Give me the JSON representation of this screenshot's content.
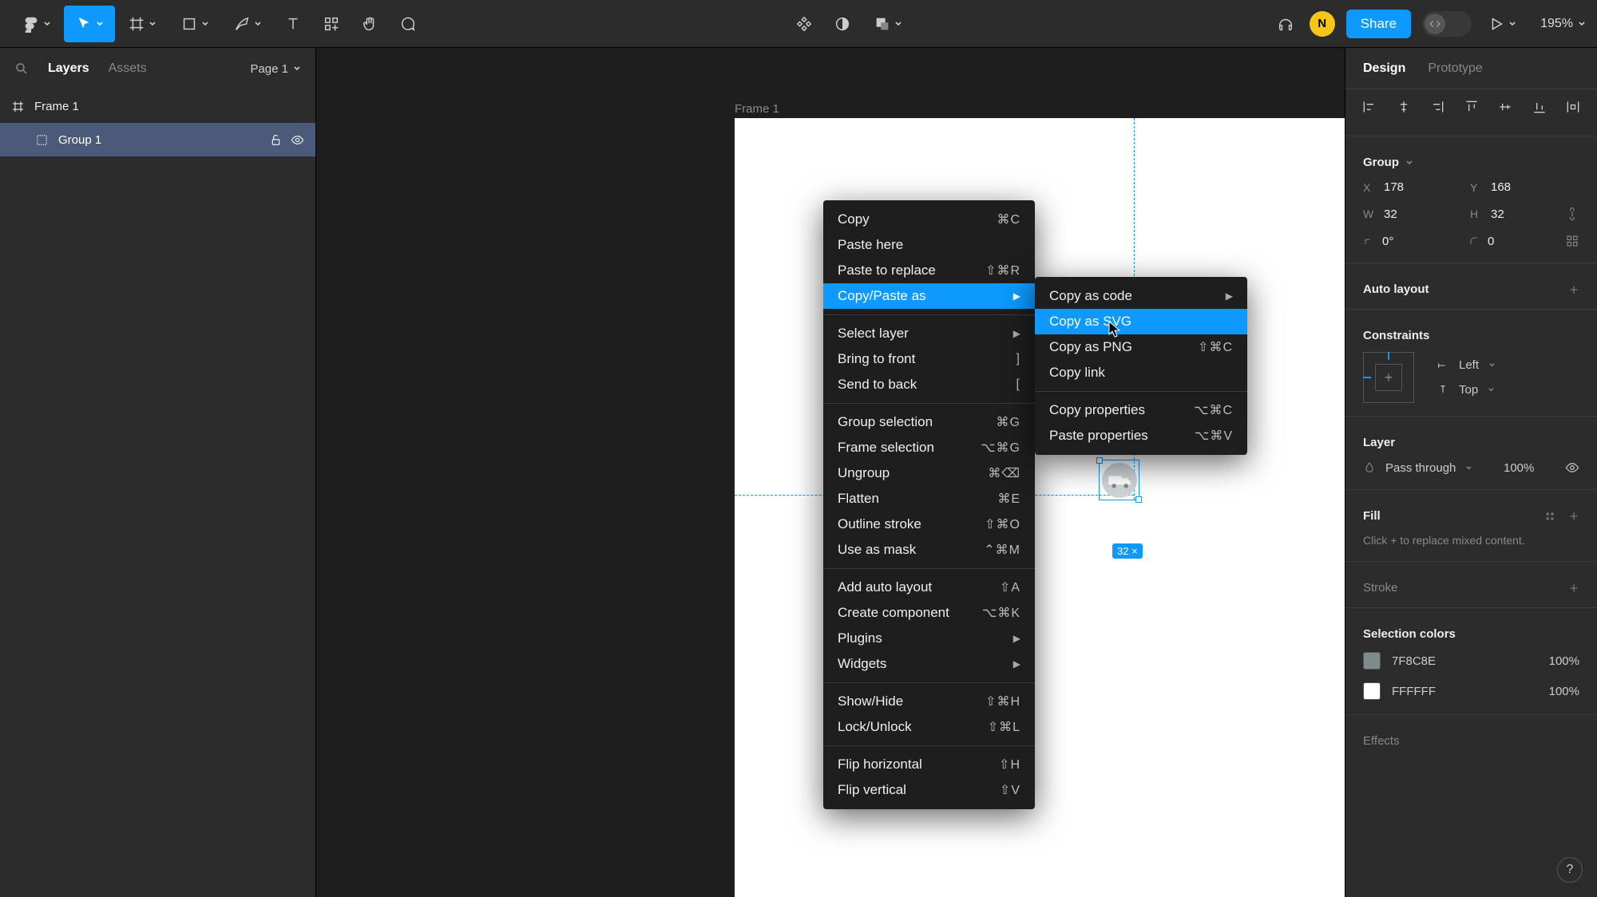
{
  "topbar": {
    "share": "Share",
    "zoom": "195%",
    "avatar_initial": "N"
  },
  "leftpanel": {
    "tabs": {
      "layers": "Layers",
      "assets": "Assets"
    },
    "page_selector": "Page 1",
    "layers": [
      {
        "name": "Frame 1",
        "type": "frame"
      },
      {
        "name": "Group 1",
        "type": "group",
        "selected": true
      }
    ]
  },
  "canvas": {
    "frame_label": "Frame 1",
    "selection_dims": "32 ×"
  },
  "context_menu": {
    "items": [
      {
        "label": "Copy",
        "shortcut": "⌘C"
      },
      {
        "label": "Paste here",
        "shortcut": ""
      },
      {
        "label": "Paste to replace",
        "shortcut": "⇧⌘R"
      },
      {
        "label": "Copy/Paste as",
        "shortcut": "",
        "submenu": true,
        "hov": true
      },
      {
        "sep": true
      },
      {
        "label": "Select layer",
        "shortcut": "",
        "submenu": true
      },
      {
        "label": "Bring to front",
        "shortcut": "]"
      },
      {
        "label": "Send to back",
        "shortcut": "["
      },
      {
        "sep": true
      },
      {
        "label": "Group selection",
        "shortcut": "⌘G"
      },
      {
        "label": "Frame selection",
        "shortcut": "⌥⌘G"
      },
      {
        "label": "Ungroup",
        "shortcut": "⌘⌫"
      },
      {
        "label": "Flatten",
        "shortcut": "⌘E"
      },
      {
        "label": "Outline stroke",
        "shortcut": "⇧⌘O"
      },
      {
        "label": "Use as mask",
        "shortcut": "⌃⌘M"
      },
      {
        "sep": true
      },
      {
        "label": "Add auto layout",
        "shortcut": "⇧A"
      },
      {
        "label": "Create component",
        "shortcut": "⌥⌘K"
      },
      {
        "label": "Plugins",
        "shortcut": "",
        "submenu": true
      },
      {
        "label": "Widgets",
        "shortcut": "",
        "submenu": true
      },
      {
        "sep": true
      },
      {
        "label": "Show/Hide",
        "shortcut": "⇧⌘H"
      },
      {
        "label": "Lock/Unlock",
        "shortcut": "⇧⌘L"
      },
      {
        "sep": true
      },
      {
        "label": "Flip horizontal",
        "shortcut": "⇧H"
      },
      {
        "label": "Flip vertical",
        "shortcut": "⇧V"
      }
    ]
  },
  "submenu": {
    "items": [
      {
        "label": "Copy as code",
        "shortcut": "",
        "submenu": true
      },
      {
        "label": "Copy as SVG",
        "shortcut": "",
        "hov": true
      },
      {
        "label": "Copy as PNG",
        "shortcut": "⇧⌘C"
      },
      {
        "label": "Copy link",
        "shortcut": ""
      },
      {
        "sep": true
      },
      {
        "label": "Copy properties",
        "shortcut": "⌥⌘C"
      },
      {
        "label": "Paste properties",
        "shortcut": "⌥⌘V"
      }
    ]
  },
  "right": {
    "tabs": {
      "design": "Design",
      "prototype": "Prototype"
    },
    "group_label": "Group",
    "x": "178",
    "y": "168",
    "w": "32",
    "h": "32",
    "rot": "0°",
    "radius": "0",
    "auto_layout": "Auto layout",
    "constraints": "Constraints",
    "constraint_h": "Left",
    "constraint_v": "Top",
    "layer": "Layer",
    "blend": "Pass through",
    "opacity": "100%",
    "fill": "Fill",
    "fill_help": "Click + to replace mixed content.",
    "stroke": "Stroke",
    "sel_colors": "Selection colors",
    "color1_hex": "7F8C8E",
    "color1_op": "100%",
    "color2_hex": "FFFFFF",
    "color2_op": "100%",
    "effects": "Effects"
  }
}
